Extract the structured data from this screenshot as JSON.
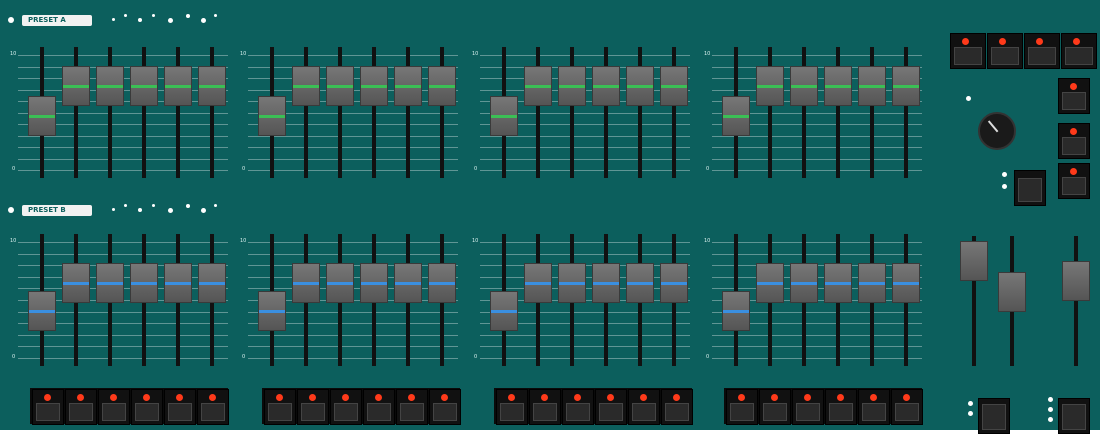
{
  "presets": {
    "top_label": "PRESET A",
    "bottom_label": "PRESET B"
  },
  "top_channels": [
    {
      "level": 0.45
    },
    {
      "level": 0.85
    },
    {
      "level": 0.85
    },
    {
      "level": 0.85
    },
    {
      "level": 0.85
    },
    {
      "level": 0.85
    },
    {
      "level": 0.45
    },
    {
      "level": 0.85
    },
    {
      "level": 0.85
    },
    {
      "level": 0.85
    },
    {
      "level": 0.85
    },
    {
      "level": 0.85
    },
    {
      "level": 0.45
    },
    {
      "level": 0.85
    },
    {
      "level": 0.85
    },
    {
      "level": 0.85
    },
    {
      "level": 0.85
    },
    {
      "level": 0.85
    },
    {
      "level": 0.45
    },
    {
      "level": 0.85
    },
    {
      "level": 0.85
    },
    {
      "level": 0.85
    },
    {
      "level": 0.85
    },
    {
      "level": 0.85
    }
  ],
  "bottom_channels": [
    {
      "level": 0.35
    },
    {
      "level": 0.72
    },
    {
      "level": 0.72
    },
    {
      "level": 0.72
    },
    {
      "level": 0.72
    },
    {
      "level": 0.72
    },
    {
      "level": 0.35
    },
    {
      "level": 0.72
    },
    {
      "level": 0.72
    },
    {
      "level": 0.72
    },
    {
      "level": 0.72
    },
    {
      "level": 0.72
    },
    {
      "level": 0.35
    },
    {
      "level": 0.72
    },
    {
      "level": 0.72
    },
    {
      "level": 0.72
    },
    {
      "level": 0.72
    },
    {
      "level": 0.72
    },
    {
      "level": 0.35
    },
    {
      "level": 0.72
    },
    {
      "level": 0.72
    },
    {
      "level": 0.72
    },
    {
      "level": 0.72
    },
    {
      "level": 0.72
    }
  ],
  "master_levels": [
    0.95,
    0.6,
    0.72
  ],
  "scale_top": "10",
  "scale_bottom": "0",
  "scene_buttons_count": 4,
  "bank_group_count": 4,
  "colors": {
    "panel": "#0c5f5d",
    "led": "#ff3a1a",
    "green_stripe": "#3bbf55",
    "blue_stripe": "#3a8fe0"
  }
}
